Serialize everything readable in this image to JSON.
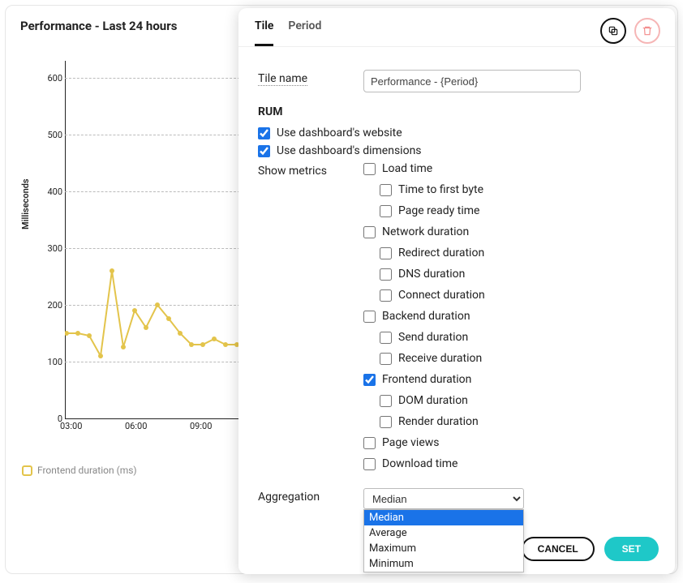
{
  "card": {
    "title": "Performance - Last 24 hours"
  },
  "chart_data": {
    "type": "line",
    "title": "Performance - Last 24 hours",
    "xlabel": "",
    "ylabel": "Milliseconds",
    "ylim": [
      0,
      630
    ],
    "y_ticks": [
      0,
      100,
      200,
      300,
      400,
      500,
      600
    ],
    "x_ticks": [
      "03:00",
      "06:00",
      "09:00"
    ],
    "series": [
      {
        "name": "Frontend duration (ms)",
        "color": "#e3c44b",
        "values": [
          150,
          150,
          145,
          110,
          260,
          125,
          190,
          160,
          200,
          175,
          150,
          130,
          130,
          140,
          130,
          130
        ]
      }
    ]
  },
  "legend": {
    "label": "Frontend duration (ms)"
  },
  "panel": {
    "tabs": {
      "tile": "Tile",
      "period": "Period"
    },
    "tile_name_label": "Tile name",
    "tile_name_value": "Performance - {Period}",
    "section": "RUM",
    "use_website": "Use dashboard's website",
    "use_dimensions": "Use dashboard's dimensions",
    "show_metrics_label": "Show metrics",
    "metrics": {
      "load_time": "Load time",
      "ttfb": "Time to first byte",
      "page_ready": "Page ready time",
      "network": "Network duration",
      "redirect": "Redirect duration",
      "dns": "DNS duration",
      "connect": "Connect duration",
      "backend": "Backend duration",
      "send": "Send duration",
      "receive": "Receive duration",
      "frontend": "Frontend duration",
      "dom": "DOM duration",
      "render": "Render duration",
      "page_views": "Page views",
      "download": "Download time"
    },
    "aggregation_label": "Aggregation",
    "aggregation_value": "Median",
    "aggregation_options": {
      "median": "Median",
      "average": "Average",
      "maximum": "Maximum",
      "minimum": "Minimum"
    },
    "cancel": "CANCEL",
    "set": "SET"
  }
}
